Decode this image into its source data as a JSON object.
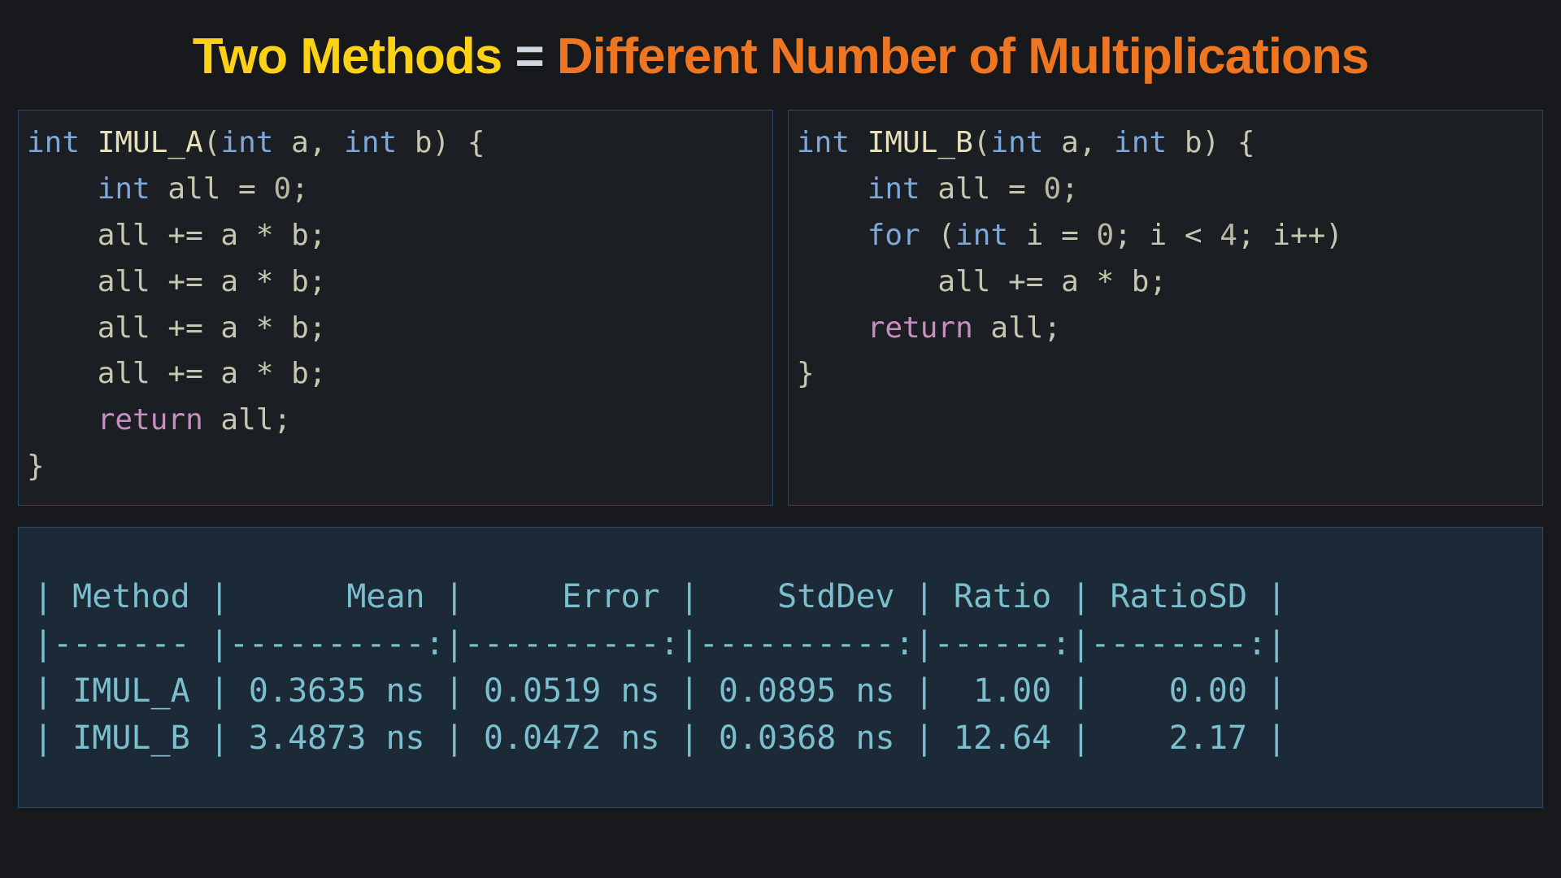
{
  "title": {
    "part1": "Two Methods",
    "eq": " = ",
    "part2": "Different Number of Multiplications"
  },
  "code_a": {
    "l1_int": "int",
    "l1_fn": " IMUL_A",
    "l1_paren_open": "(",
    "l1_p1_t": "int",
    "l1_p1": " a, ",
    "l1_p2_t": "int",
    "l1_p2": " b) {",
    "l2_indent": "    ",
    "l2_int": "int",
    "l2_rest": " all = ",
    "l2_zero": "0",
    "l2_semi": ";",
    "l3": "    all += a * b;",
    "l4": "    all += a * b;",
    "l5": "    all += a * b;",
    "l6": "    all += a * b;",
    "l7_indent": "    ",
    "l7_ret": "return",
    "l7_rest": " all;",
    "l8": "}"
  },
  "code_b": {
    "l1_int": "int",
    "l1_fn": " IMUL_B",
    "l1_paren_open": "(",
    "l1_p1_t": "int",
    "l1_p1": " a, ",
    "l1_p2_t": "int",
    "l1_p2": " b) {",
    "l2_indent": "    ",
    "l2_int": "int",
    "l2_rest": " all = ",
    "l2_zero": "0",
    "l2_semi": ";",
    "l3_indent": "    ",
    "l3_for": "for",
    "l3_open": " (",
    "l3_int": "int",
    "l3_init": " i = ",
    "l3_zero": "0",
    "l3_cond": "; i < ",
    "l3_four": "4",
    "l3_rest": "; i++)",
    "l4": "        all += a * b;",
    "l5_indent": "    ",
    "l5_ret": "return",
    "l5_rest": " all;",
    "l6": "}"
  },
  "bench": {
    "header": "| Method |      Mean |     Error |    StdDev | Ratio | RatioSD |",
    "sep": "|------- |----------:|----------:|----------:|------:|--------:|",
    "row_a": "| IMUL_A | 0.3635 ns | 0.0519 ns | 0.0895 ns |  1.00 |    0.00 |",
    "row_b": "| IMUL_B | 3.4873 ns | 0.0472 ns | 0.0368 ns | 12.64 |    2.17 |"
  },
  "chart_data": {
    "type": "table",
    "title": "Two Methods = Different Number of Multiplications",
    "columns": [
      "Method",
      "Mean",
      "Error",
      "StdDev",
      "Ratio",
      "RatioSD"
    ],
    "rows": [
      {
        "Method": "IMUL_A",
        "Mean": "0.3635 ns",
        "Error": "0.0519 ns",
        "StdDev": "0.0895 ns",
        "Ratio": 1.0,
        "RatioSD": 0.0
      },
      {
        "Method": "IMUL_B",
        "Mean": "3.4873 ns",
        "Error": "0.0472 ns",
        "StdDev": "0.0368 ns",
        "Ratio": 12.64,
        "RatioSD": 2.17
      }
    ]
  }
}
